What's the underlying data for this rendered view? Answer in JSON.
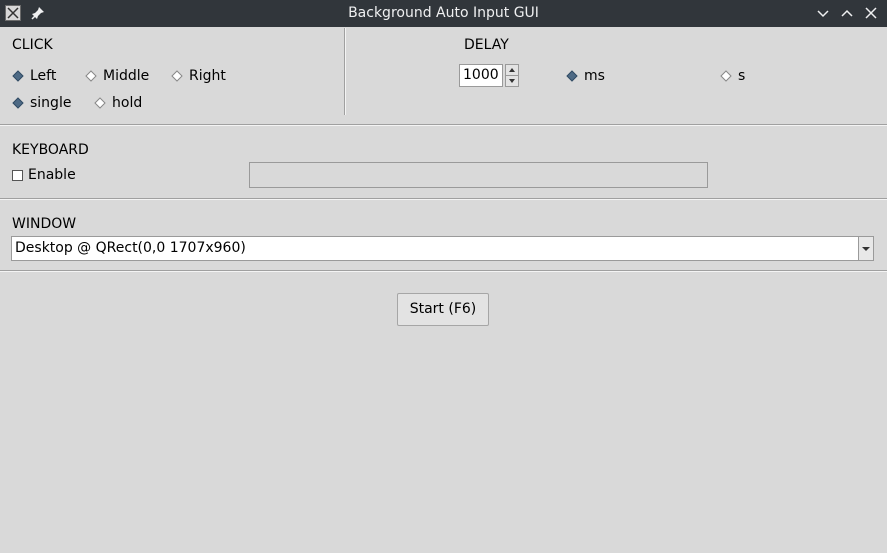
{
  "window": {
    "title": "Background Auto Input GUI"
  },
  "click": {
    "title": "CLICK",
    "buttons": [
      {
        "label": "Left",
        "selected": true
      },
      {
        "label": "Middle",
        "selected": false
      },
      {
        "label": "Right",
        "selected": false
      }
    ],
    "modes": [
      {
        "label": "single",
        "selected": true
      },
      {
        "label": "hold",
        "selected": false
      }
    ]
  },
  "delay": {
    "title": "DELAY",
    "value": "1000",
    "units": [
      {
        "label": "ms",
        "selected": true
      },
      {
        "label": "s",
        "selected": false
      }
    ]
  },
  "keyboard": {
    "title": "KEYBOARD",
    "enable_label": "Enable",
    "enabled": false,
    "text_value": ""
  },
  "window_section": {
    "title": "WINDOW",
    "selected": "Desktop @ QRect(0,0 1707x960)"
  },
  "start_button": {
    "label": "Start (F6)"
  },
  "colors": {
    "titlebar": "#31363b",
    "panel": "#d9d9d9",
    "radio_selected": "#4e6a85"
  }
}
